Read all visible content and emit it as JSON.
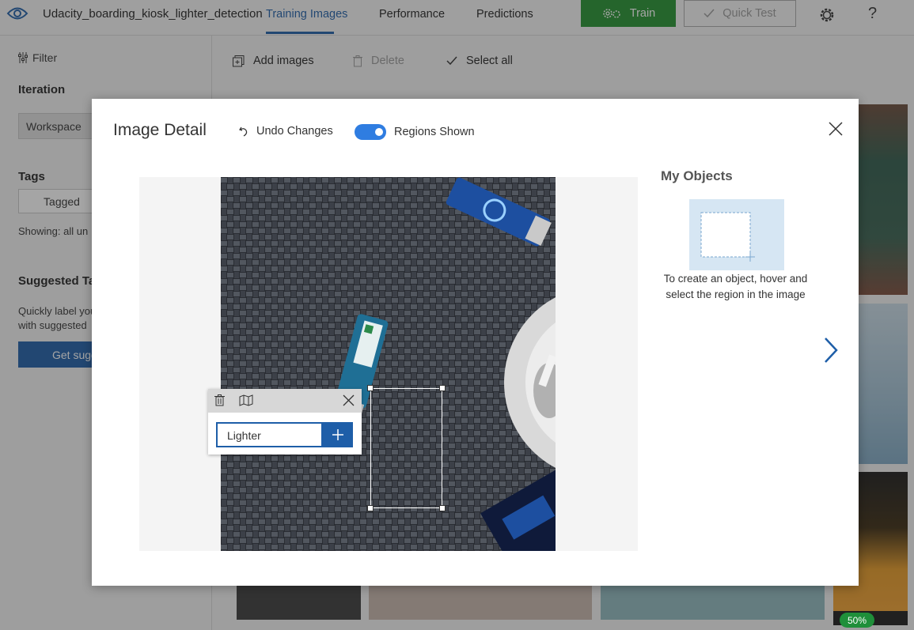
{
  "topbar": {
    "project_name": "Udacity_boarding_kiosk_lighter_detection",
    "tabs": [
      {
        "label": "Training Images",
        "active": true
      },
      {
        "label": "Performance",
        "active": false
      },
      {
        "label": "Predictions",
        "active": false
      }
    ],
    "train_label": "Train",
    "quick_test_label": "Quick Test",
    "help_label": "?",
    "accent_color": "#1e5ea8",
    "train_color": "#24912f"
  },
  "sidebar": {
    "filter_label": "Filter",
    "iteration_heading": "Iteration",
    "iteration_value": "Workspace",
    "tags_heading": "Tags",
    "tagged_button": "Tagged",
    "showing_text": "Showing: all un",
    "suggested_heading": "Suggested Ta",
    "suggested_text_line1": "Quickly label you",
    "suggested_text_line2": "with suggested",
    "get_suggested_button": "Get sugg"
  },
  "toolbar": {
    "add_images": "Add images",
    "delete": "Delete",
    "select_all": "Select all"
  },
  "modal": {
    "title": "Image Detail",
    "undo_label": "Undo Changes",
    "regions_toggle_label": "Regions Shown",
    "regions_shown": true,
    "tag_input_value": "Lighter",
    "my_objects_title": "My Objects",
    "my_objects_hint": "To create an object, hover and select the region in the image"
  },
  "background": {
    "progress_badge": "50%"
  }
}
